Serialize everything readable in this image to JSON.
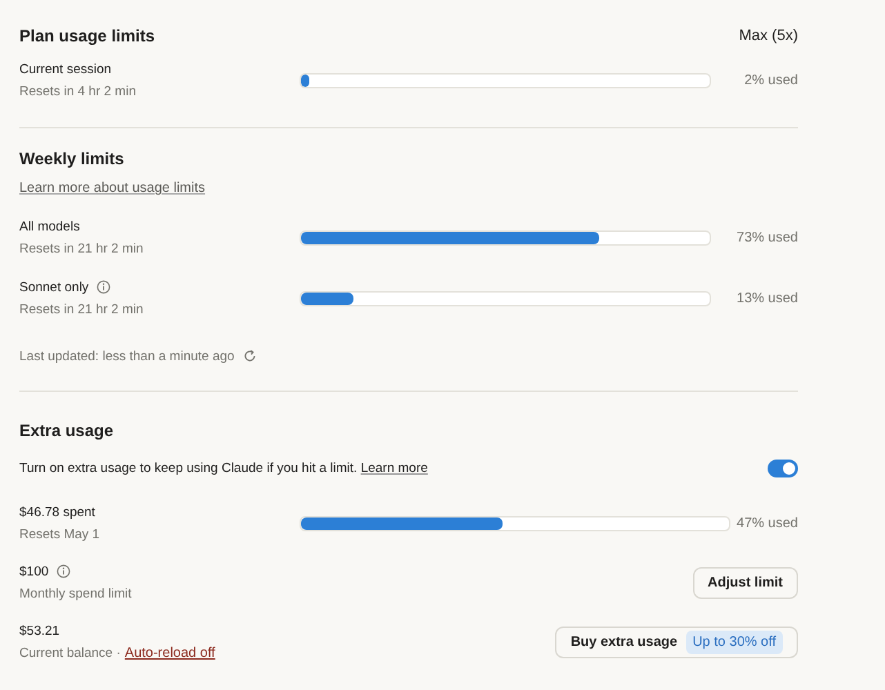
{
  "plan": {
    "title": "Plan usage limits",
    "plan_name": "Max (5x)",
    "meters": [
      {
        "name": "Current session",
        "sub": "Resets in 4 hr 2 min",
        "level": 0.02,
        "reading": "2% used",
        "info": false
      }
    ]
  },
  "weekly": {
    "title": "Weekly limits",
    "link": "Learn more about usage limits",
    "meters": [
      {
        "name": "All models",
        "sub": "Resets in 21 hr 2 min",
        "level": 0.73,
        "reading": "73% used",
        "info": false
      },
      {
        "name": "Sonnet only",
        "sub": "Resets in 21 hr 2 min",
        "level": 0.13,
        "reading": "13% used",
        "info": true
      }
    ],
    "last_updated": "Last updated: less than a minute ago"
  },
  "extra": {
    "title": "Extra usage",
    "description": "Turn on extra usage to keep using Claude if you hit a limit.",
    "description_link": "Learn more",
    "on": true,
    "spent": {
      "name": "$46.78 spent",
      "sub": "Resets May 1",
      "level": 0.47,
      "reading": "47% used"
    },
    "limit": {
      "name": "$100",
      "sub": "Monthly spend limit",
      "info": true,
      "button": "Adjust limit"
    },
    "balance": {
      "name": "$53.21",
      "sub": "Current balance ·",
      "link": "Auto-reload off",
      "button": "Buy extra usage",
      "badge": "Up to 30% off"
    }
  }
}
